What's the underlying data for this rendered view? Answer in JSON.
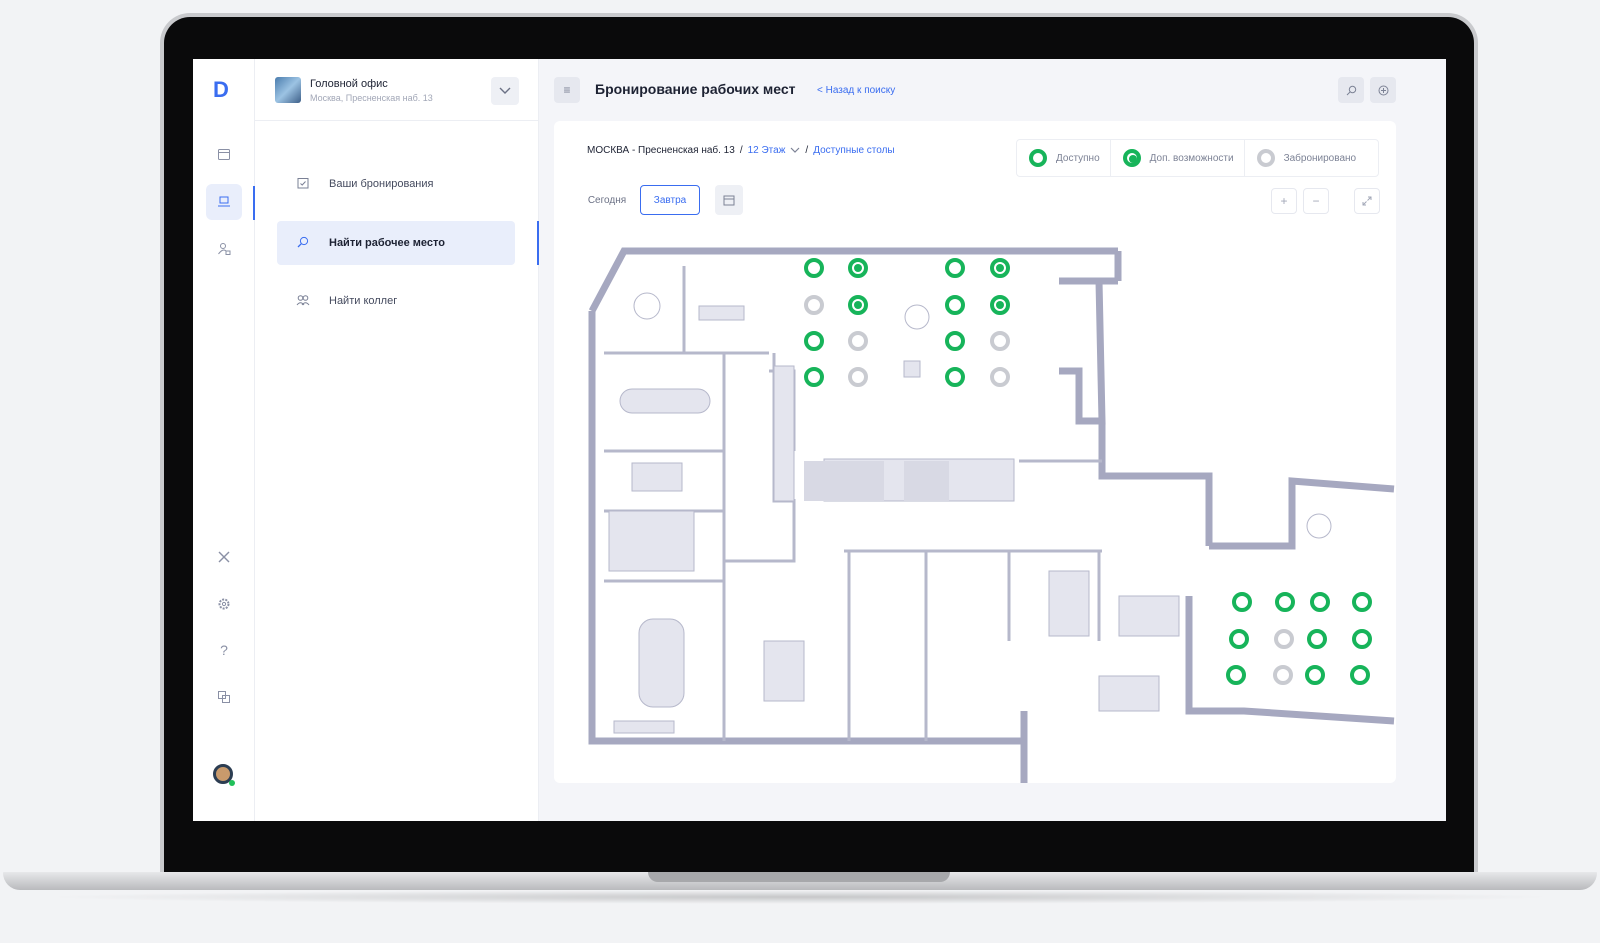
{
  "rail": {
    "logo": "D",
    "icons": [
      "calendar-icon",
      "desk-icon",
      "user-lock-icon",
      "tools-icon",
      "gear-icon",
      "help-icon",
      "translate-icon"
    ]
  },
  "office": {
    "name": "Головной офис",
    "address": "Москва, Пресненская наб. 13"
  },
  "menu": {
    "items": [
      {
        "label": "Ваши бронирования",
        "icon": "calendar-check-icon"
      },
      {
        "label": "Найти рабочее место",
        "icon": "search-location-icon"
      },
      {
        "label": "Найти коллег",
        "icon": "people-icon"
      }
    ]
  },
  "header": {
    "title": "Бронирование рабочих мест",
    "back_link": "< Назад к поиску"
  },
  "breadcrumbs": {
    "location": "МОСКВА - Пресненская наб. 13",
    "sep1": "/",
    "floor": "12 Этаж",
    "sep2": "/",
    "section": "Доступные столы"
  },
  "legend": {
    "available": "Доступно",
    "extra": "Доп. возможности",
    "booked": "Забронировано"
  },
  "days": {
    "today": "Сегодня",
    "tomorrow": "Завтра"
  },
  "zoom": {
    "plus": "+",
    "minus": "−"
  },
  "colors": {
    "accent": "#3a6df0",
    "available": "#17b45a",
    "booked": "#c9cbd1",
    "wall": "#a6a8c0"
  },
  "seats": [
    {
      "status": "available"
    },
    {
      "status": "extra"
    },
    {
      "status": "available"
    },
    {
      "status": "extra"
    },
    {
      "status": "booked"
    },
    {
      "status": "extra"
    },
    {
      "status": "available"
    },
    {
      "status": "extra"
    },
    {
      "status": "available"
    },
    {
      "status": "booked"
    },
    {
      "status": "available"
    },
    {
      "status": "booked"
    },
    {
      "status": "available"
    },
    {
      "status": "booked"
    },
    {
      "status": "available"
    },
    {
      "status": "booked"
    },
    {
      "status": "available"
    },
    {
      "status": "available"
    },
    {
      "status": "available"
    },
    {
      "status": "available"
    },
    {
      "status": "available"
    },
    {
      "status": "booked"
    },
    {
      "status": "available"
    },
    {
      "status": "available"
    },
    {
      "status": "available"
    },
    {
      "status": "booked"
    },
    {
      "status": "available"
    },
    {
      "status": "available"
    }
  ]
}
